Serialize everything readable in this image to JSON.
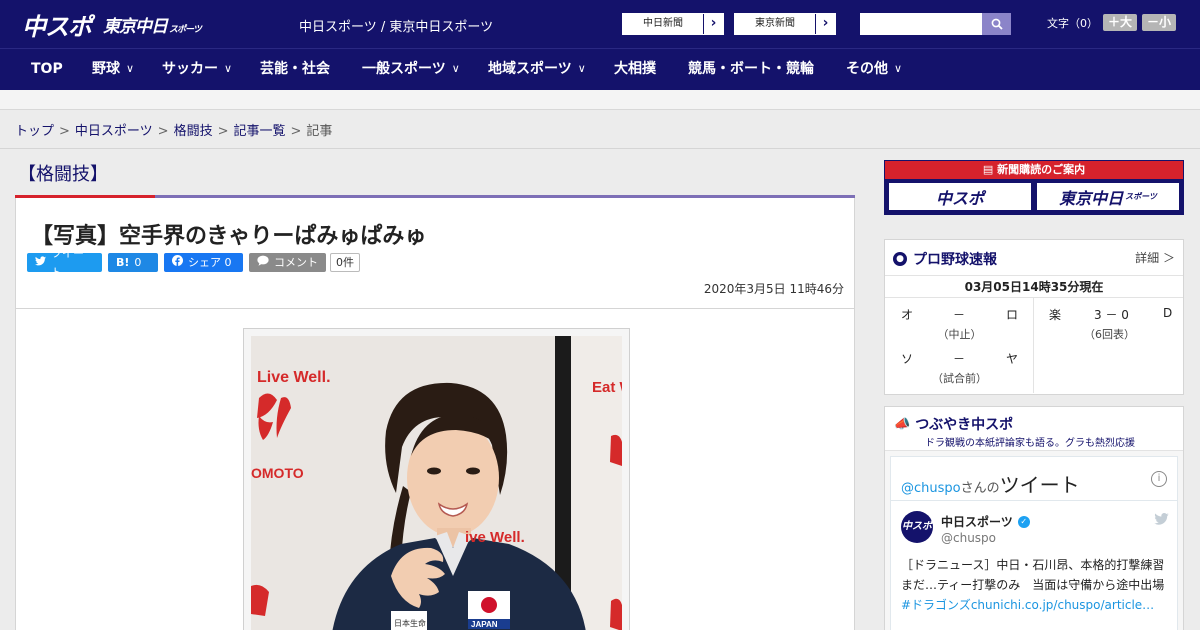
{
  "header": {
    "logo_chuspo": "中スポ",
    "logo_tokyo": "東京中日",
    "logo_tokyo_sub": "スポーツ",
    "site_title": "中日スポーツ / 東京中日スポーツ",
    "ext_links": [
      {
        "label": "中日新聞"
      },
      {
        "label": "東京新聞"
      }
    ],
    "search_placeholder": "",
    "fontsize_label": "文字（0）",
    "fontsize_up": "＋大",
    "fontsize_down": "－小"
  },
  "nav": {
    "items": [
      {
        "label": "TOP"
      },
      {
        "label": "野球"
      },
      {
        "label": "サッカー"
      },
      {
        "label": "芸能・社会"
      },
      {
        "label": "一般スポーツ"
      },
      {
        "label": "地域スポーツ"
      },
      {
        "label": "大相撲"
      },
      {
        "label": "競馬・ボート・競輪"
      },
      {
        "label": "その他"
      }
    ]
  },
  "breadcrumb": {
    "items": [
      "トップ",
      "中日スポーツ",
      "格闘技",
      "記事一覧"
    ],
    "current": "記事",
    "separator": ">"
  },
  "category": {
    "heading": "【格闘技】"
  },
  "article": {
    "title": "【写真】空手界のきゃりーぱみゅぱみゅ",
    "share": {
      "tweet_label": "ツイート",
      "hatena_icon": "B!",
      "hatena_count": "0",
      "facebook_label": "シェア",
      "facebook_count": "0",
      "comment_label": "コメント",
      "comment_count": "0件"
    },
    "date": "2020年3月5日 11時46分",
    "photo_texts": {
      "live_well": "Live Well.",
      "eat": "Eat W",
      "omoto": "OMOTO",
      "live_well_2": "ive Well.",
      "japan": "JAPAN",
      "nihon_seimei": "日本生命"
    }
  },
  "sidebar": {
    "subscribe": {
      "head": "新聞購読のご案内",
      "logo1": "中スポ",
      "logo2": "東京中日",
      "logo2_sub": "スポーツ"
    },
    "baseball": {
      "title": "プロ野球速報",
      "more": "詳細 ＞",
      "time": "03月05日14時35分現在",
      "games_left": [
        {
          "home": "オ",
          "score": "－",
          "away": "ロ",
          "status": "（中止）"
        },
        {
          "home": "ソ",
          "score": "－",
          "away": "ヤ",
          "status": "（試合前）"
        }
      ],
      "games_right": [
        {
          "home": "楽",
          "score": "3 － 0",
          "away": "D",
          "status": "（6回表）"
        }
      ]
    },
    "tweets": {
      "title": "つぶやき中スポ",
      "subtitle": "ドラ観戦の本紙評論家も語る。グラも熱烈応援",
      "handle_prefix": "@chuspo",
      "handle_suffix": "さんの",
      "heading_big": "ツイート",
      "info_icon": "i",
      "account_name": "中日スポーツ",
      "account_handle": "@chuspo",
      "avatar_text": "中スポ",
      "text": "［ドラニュース］中日・石川昂、本格的打撃練習まだ…ティー打撃のみ　当面は守備から途中出場",
      "hashtag": "#ドラゴンズ",
      "link": "chunichi.co.jp/chuspo/article…"
    }
  },
  "colors": {
    "brand_navy": "#14126b",
    "accent_red": "#d6222c",
    "accent_purple": "#7d6fb6"
  }
}
